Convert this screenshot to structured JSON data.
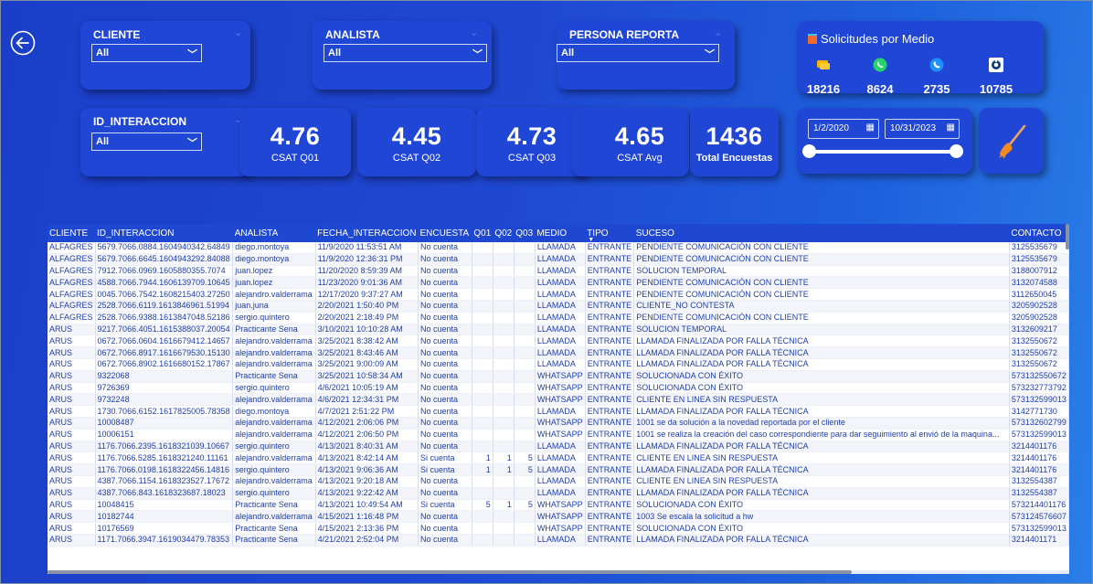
{
  "filters": {
    "cliente": {
      "label": "CLIENTE",
      "value": "All"
    },
    "analista": {
      "label": "ANALISTA",
      "value": "All"
    },
    "persona": {
      "label": "PERSONA REPORTA",
      "value": "All"
    },
    "id_interaccion": {
      "label": "ID_INTERACCION",
      "value": "All"
    }
  },
  "solicitudes": {
    "title": "Solicitudes por Medio",
    "items": [
      {
        "icon": "chat-icon",
        "value": "18216",
        "color": "#f5b400"
      },
      {
        "icon": "whatsapp-icon",
        "value": "8624",
        "color": "#25d366"
      },
      {
        "icon": "phone-icon",
        "value": "2735",
        "color": "#1e90ff"
      },
      {
        "icon": "app-icon",
        "value": "10785",
        "color": "#ffffff"
      }
    ]
  },
  "kpis": [
    {
      "value": "4.76",
      "label": "CSAT Q01"
    },
    {
      "value": "4.45",
      "label": "CSAT Q02"
    },
    {
      "value": "4.73",
      "label": "CSAT Q03"
    },
    {
      "value": "4.65",
      "label": "CSAT Avg"
    },
    {
      "value": "1436",
      "label": "Total Encuestas"
    }
  ],
  "date_range": {
    "start": "1/2/2020",
    "end": "10/31/2023"
  },
  "table": {
    "columns": [
      "CLIENTE",
      "ID_INTERACCION",
      "ANALISTA",
      "FECHA_INTERACCION",
      "ENCUESTA",
      "Q01",
      "Q02",
      "Q03",
      "MEDIO",
      "TIPO",
      "SUCESO",
      "CONTACTO"
    ],
    "rows": [
      [
        "ALFAGRES",
        "5679.7066.0884.1604940342.64849",
        "diego.montoya",
        "11/9/2020 11:53:51 AM",
        "No cuenta",
        "",
        "",
        "",
        "LLAMADA",
        "ENTRANTE",
        "PENDIENTE COMUNICACIÓN CON CLIENTE",
        "3125535679"
      ],
      [
        "ALFAGRES",
        "5679.7066.6645.1604943292.84088",
        "diego.montoya",
        "11/9/2020 12:36:31 PM",
        "No cuenta",
        "",
        "",
        "",
        "LLAMADA",
        "ENTRANTE",
        "PENDIENTE COMUNICACIÓN CON CLIENTE",
        "3125535679"
      ],
      [
        "ALFAGRES",
        "7912.7066.0969.1605880355.7074",
        "juan.lopez",
        "11/20/2020 8:59:39 AM",
        "No cuenta",
        "",
        "",
        "",
        "LLAMADA",
        "ENTRANTE",
        "SOLUCION TEMPORAL",
        "3188007912"
      ],
      [
        "ALFAGRES",
        "4588.7066.7944.1606139709.10645",
        "juan.lopez",
        "11/23/2020 9:01:36 AM",
        "No cuenta",
        "",
        "",
        "",
        "LLAMADA",
        "ENTRANTE",
        "PENDIENTE COMUNICACIÓN CON CLIENTE",
        "3132074588"
      ],
      [
        "ALFAGRES",
        "0045.7066.7542.1608215403.27250",
        "alejandro.valderrama",
        "12/17/2020 9:37:27 AM",
        "No cuenta",
        "",
        "",
        "",
        "LLAMADA",
        "ENTRANTE",
        "PENDIENTE COMUNICACIÓN CON CLIENTE",
        "3112650045"
      ],
      [
        "ALFAGRES",
        "2528.7066.6119.1613846961.51994",
        "juan.juna",
        "2/20/2021 1:50:40 PM",
        "No cuenta",
        "",
        "",
        "",
        "LLAMADA",
        "ENTRANTE",
        "CLIENTE_NO CONTESTA",
        "3205902528"
      ],
      [
        "ALFAGRES",
        "2528.7066.9388.1613847048.52186",
        "sergio.quintero",
        "2/20/2021 2:18:49 PM",
        "No cuenta",
        "",
        "",
        "",
        "LLAMADA",
        "ENTRANTE",
        "PENDIENTE COMUNICACIÓN CON CLIENTE",
        "3205902528"
      ],
      [
        "ARUS",
        "9217.7066.4051.1615388037.20054",
        "Practicante Sena",
        "3/10/2021 10:10:28 AM",
        "No cuenta",
        "",
        "",
        "",
        "LLAMADA",
        "ENTRANTE",
        "SOLUCION TEMPORAL",
        "3132609217"
      ],
      [
        "ARUS",
        "0672.7066.0604.1616679412.14657",
        "alejandro.valderrama",
        "3/25/2021 8:38:42 AM",
        "No cuenta",
        "",
        "",
        "",
        "LLAMADA",
        "ENTRANTE",
        "LLAMADA FINALIZADA POR FALLA TÉCNICA",
        "3132550672"
      ],
      [
        "ARUS",
        "0672.7066.8917.1616679530.15130",
        "alejandro.valderrama",
        "3/25/2021 8:43:46 AM",
        "No cuenta",
        "",
        "",
        "",
        "LLAMADA",
        "ENTRANTE",
        "LLAMADA FINALIZADA POR FALLA TÉCNICA",
        "3132550672"
      ],
      [
        "ARUS",
        "0672.7066.8902.1616680152.17867",
        "alejandro.valderrama",
        "3/25/2021 9:00:09 AM",
        "No cuenta",
        "",
        "",
        "",
        "LLAMADA",
        "ENTRANTE",
        "LLAMADA FINALIZADA POR FALLA TÉCNICA",
        "3132550672"
      ],
      [
        "ARUS",
        "9322068",
        "Practicante Sena",
        "3/25/2021 10:58:34 AM",
        "No cuenta",
        "",
        "",
        "",
        "WHATSAPP",
        "ENTRANTE",
        "SOLUCIONADA CON ÉXITO",
        "573132550672"
      ],
      [
        "ARUS",
        "9726369",
        "sergio.quintero",
        "4/6/2021 10:05:19 AM",
        "No cuenta",
        "",
        "",
        "",
        "WHATSAPP",
        "ENTRANTE",
        "SOLUCIONADA CON ÉXITO",
        "573232773792"
      ],
      [
        "ARUS",
        "9732248",
        "alejandro.valderrama",
        "4/6/2021 12:34:31 PM",
        "No cuenta",
        "",
        "",
        "",
        "WHATSAPP",
        "ENTRANTE",
        "CLIENTE EN LINEA SIN RESPUESTA",
        "573132599013"
      ],
      [
        "ARUS",
        "1730.7066.6152.1617825005.78358",
        "diego.montoya",
        "4/7/2021 2:51:22 PM",
        "No cuenta",
        "",
        "",
        "",
        "LLAMADA",
        "ENTRANTE",
        "LLAMADA FINALIZADA POR FALLA TÉCNICA",
        "3142771730"
      ],
      [
        "ARUS",
        "10008487",
        "alejandro.valderrama",
        "4/12/2021 2:06:06 PM",
        "No cuenta",
        "",
        "",
        "",
        "WHATSAPP",
        "ENTRANTE",
        "1001 se da solución a la novedad reportada por el cliente",
        "573132602799"
      ],
      [
        "ARUS",
        "10006151",
        "alejandro.valderrama",
        "4/12/2021 2:06:50 PM",
        "No cuenta",
        "",
        "",
        "",
        "WHATSAPP",
        "ENTRANTE",
        "1001 se realiza la creación del caso correspondiente para dar seguimiento al envió de la maquina...",
        "573132599013"
      ],
      [
        "ARUS",
        "1176.7066.2395.1618321039.10667",
        "sergio.quintero",
        "4/13/2021 8:40:31 AM",
        "No cuenta",
        "",
        "",
        "",
        "LLAMADA",
        "ENTRANTE",
        "LLAMADA FINALIZADA POR FALLA TÉCNICA",
        "3214401176"
      ],
      [
        "ARUS",
        "1176.7066.5285.1618321240.11161",
        "alejandro.valderrama",
        "4/13/2021 8:42:14 AM",
        "Si cuenta",
        "1",
        "1",
        "5",
        "LLAMADA",
        "ENTRANTE",
        "CLIENTE EN LINEA SIN RESPUESTA",
        "3214401176"
      ],
      [
        "ARUS",
        "1176.7066.0198.1618322456.14816",
        "sergio.quintero",
        "4/13/2021 9:06:36 AM",
        "Si cuenta",
        "1",
        "1",
        "5",
        "LLAMADA",
        "ENTRANTE",
        "LLAMADA FINALIZADA POR FALLA TÉCNICA",
        "3214401176"
      ],
      [
        "ARUS",
        "4387.7066.1154.1618323527.17672",
        "alejandro.valderrama",
        "4/13/2021 9:20:18 AM",
        "No cuenta",
        "",
        "",
        "",
        "LLAMADA",
        "ENTRANTE",
        "CLIENTE EN LINEA SIN RESPUESTA",
        "3132554387"
      ],
      [
        "ARUS",
        "4387.7066.843.1618323687.18023",
        "sergio.quintero",
        "4/13/2021 9:22:42 AM",
        "No cuenta",
        "",
        "",
        "",
        "LLAMADA",
        "ENTRANTE",
        "LLAMADA FINALIZADA POR FALLA TÉCNICA",
        "3132554387"
      ],
      [
        "ARUS",
        "10048415",
        "Practicante Sena",
        "4/13/2021 10:49:54 AM",
        "Si cuenta",
        "5",
        "1",
        "5",
        "WHATSAPP",
        "ENTRANTE",
        "SOLUCIONADA CON ÉXITO",
        "573214401176"
      ],
      [
        "ARUS",
        "10182744",
        "alejandro.valderrama",
        "4/15/2021 1:16:48 PM",
        "No cuenta",
        "",
        "",
        "",
        "WHATSAPP",
        "ENTRANTE",
        "1003 Se escala la solicitud a hw",
        "573124576607"
      ],
      [
        "ARUS",
        "10176569",
        "Practicante Sena",
        "4/15/2021 2:13:36 PM",
        "No cuenta",
        "",
        "",
        "",
        "WHATSAPP",
        "ENTRANTE",
        "SOLUCIONADA CON ÉXITO",
        "573132599013"
      ],
      [
        "ARUS",
        "1171.7066.3947.1619034479.78353",
        "Practicante Sena",
        "4/21/2021 2:52:04 PM",
        "No cuenta",
        "",
        "",
        "",
        "LLAMADA",
        "ENTRANTE",
        "LLAMADA FINALIZADA POR FALLA TÉCNICA",
        "3214401171"
      ]
    ]
  }
}
